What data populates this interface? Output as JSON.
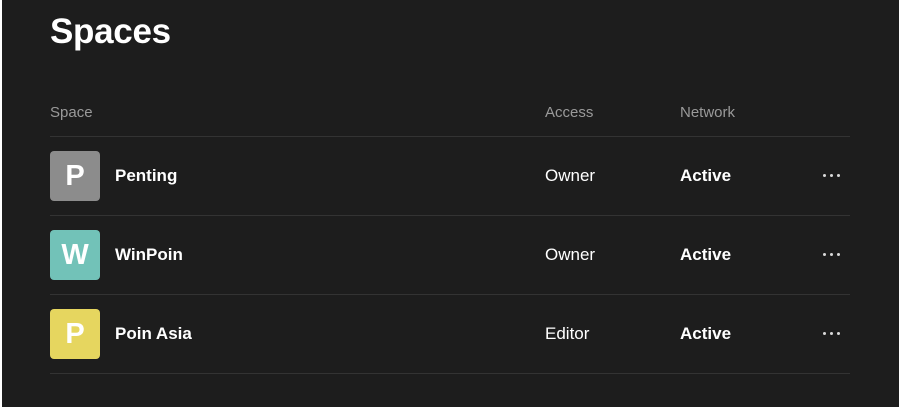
{
  "page": {
    "title": "Spaces"
  },
  "table": {
    "columns": {
      "space": "Space",
      "access": "Access",
      "network": "Network"
    },
    "rows": [
      {
        "initial": "P",
        "avatar_color": "#8c8c8c",
        "name": "Penting",
        "access": "Owner",
        "network": "Active",
        "menu_icon": "more-horizontal-icon"
      },
      {
        "initial": "W",
        "avatar_color": "#72c2b8",
        "name": "WinPoin",
        "access": "Owner",
        "network": "Active",
        "menu_icon": "more-horizontal-icon"
      },
      {
        "initial": "P",
        "avatar_color": "#e6d65f",
        "name": "Poin Asia",
        "access": "Editor",
        "network": "Active",
        "menu_icon": "more-horizontal-icon"
      }
    ]
  },
  "colors": {
    "background": "#1d1d1d",
    "divider": "#333333",
    "header_text": "#9a9a9a",
    "text": "#ffffff"
  }
}
